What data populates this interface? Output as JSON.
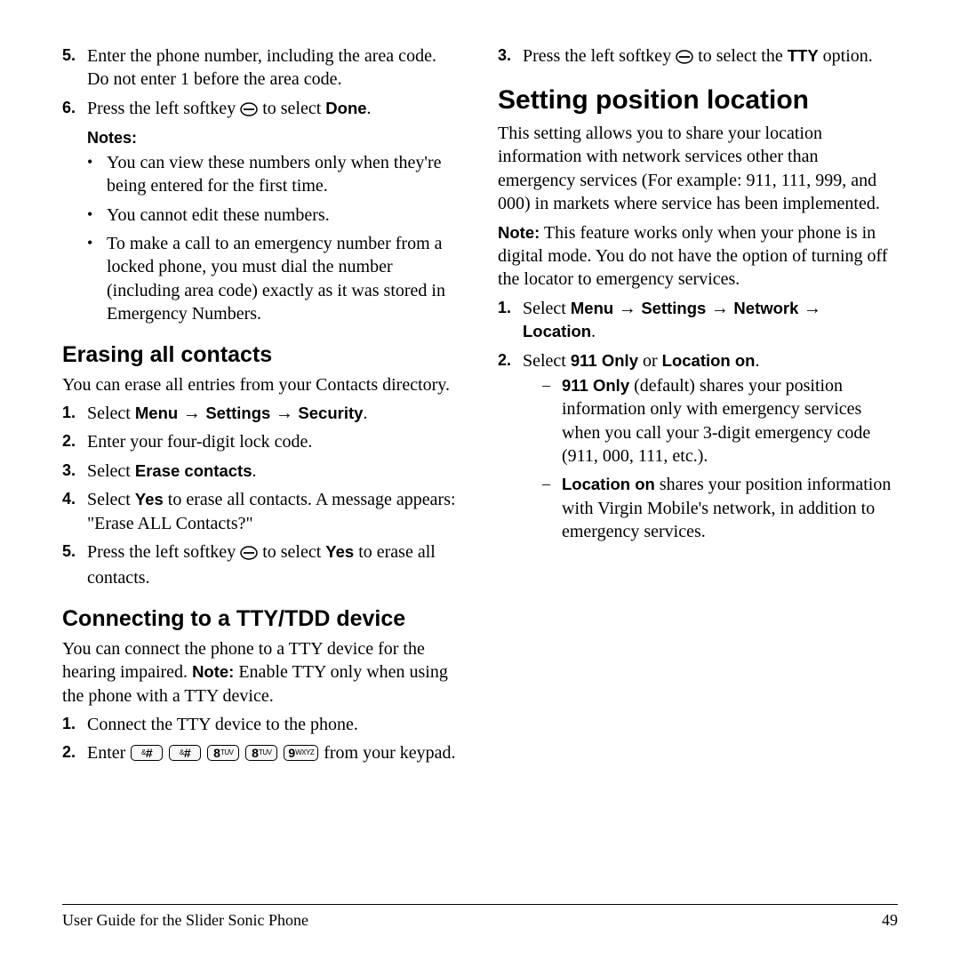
{
  "col1": {
    "topList": {
      "item5": "Enter the phone number, including the area code. Do not enter 1 before the area code.",
      "item6_a": "Press the left softkey ",
      "item6_b": " to select ",
      "item6_done": "Done",
      "item6_c": "."
    },
    "notesLabel": "Notes:",
    "notes": {
      "n1": "You can view these numbers only when they're being entered for the first time.",
      "n2": "You cannot edit these numbers.",
      "n3": "To make a call to an emergency number from a locked phone, you must dial the number (including area code) exactly as it was stored in Emergency Numbers."
    },
    "erase": {
      "title": "Erasing all contacts",
      "intro": "You can erase all entries from your Contacts directory.",
      "steps": {
        "s1_a": "Select ",
        "s1_menu": "Menu",
        "s1_arrow": " → ",
        "s1_settings": "Settings",
        "s1_security": "Security",
        "s1_b": ".",
        "s2": "Enter your four-digit lock code.",
        "s3_a": "Select ",
        "s3_erase": "Erase contacts",
        "s3_b": ".",
        "s4_a": "Select ",
        "s4_yes": "Yes",
        "s4_b": " to erase all contacts. A message appears: \"Erase ALL Contacts?\"",
        "s5_a": "Press the left softkey ",
        "s5_b": " to select ",
        "s5_yes": "Yes",
        "s5_c": " to erase all contacts."
      }
    },
    "tty": {
      "title": "Connecting to a TTY/TDD device",
      "intro_a": "You can connect the phone to a TTY device for the hearing impaired. ",
      "intro_note": "Note:",
      "intro_b": " Enable TTY only when using the phone with a TTY device.",
      "s1": "Connect the TTY device to the phone.",
      "s2_a": "Enter ",
      "s2_b": " from your keypad.",
      "keys": {
        "k1_main": "#",
        "k1_sub": "",
        "k2_main": "#",
        "k2_sub": "",
        "k3_main": "8",
        "k3_sub": "TUV",
        "k4_main": "8",
        "k4_sub": "TUV",
        "k5_main": "9",
        "k5_sub": "WXYZ"
      }
    }
  },
  "col2": {
    "s3_a": "Press the left softkey ",
    "s3_b": " to select the ",
    "s3_tty": "TTY",
    "s3_c": " option.",
    "loc": {
      "title": "Setting position location",
      "intro": "This setting allows you to share your location information with network services other than emergency services (For example: 911, 111, 999, and 000) in markets where service has been implemented.",
      "note_label": "Note:",
      "note": "  This feature works only when your phone is in digital mode. You do not have the option of turning off the locator to emergency services.",
      "steps": {
        "s1_a": "Select ",
        "s1_menu": "Menu",
        "s1_arrow": " → ",
        "s1_settings": "Settings",
        "s1_network": "Network",
        "s1_location": "Location",
        "s1_b": ".",
        "s2_a": "Select ",
        "s2_911": "911 Only",
        "s2_or": " or ",
        "s2_locon": "Location on",
        "s2_b": "."
      },
      "sub": {
        "d1_label": "911 Only",
        "d1": " (default) shares your position information only with emergency services when you call your 3-digit emergency code (911, 000, 111, etc.).",
        "d2_label": "Location on",
        "d2": " shares your position information with Virgin Mobile's network, in addition to emergency services."
      }
    }
  },
  "footer": {
    "left": "User Guide for the Slider Sonic Phone",
    "right": "49"
  },
  "nums": {
    "n1": "1.",
    "n2": "2.",
    "n3": "3.",
    "n4": "4.",
    "n5": "5.",
    "n6": "6."
  },
  "marks": {
    "bullet": "•",
    "dash": "–"
  }
}
